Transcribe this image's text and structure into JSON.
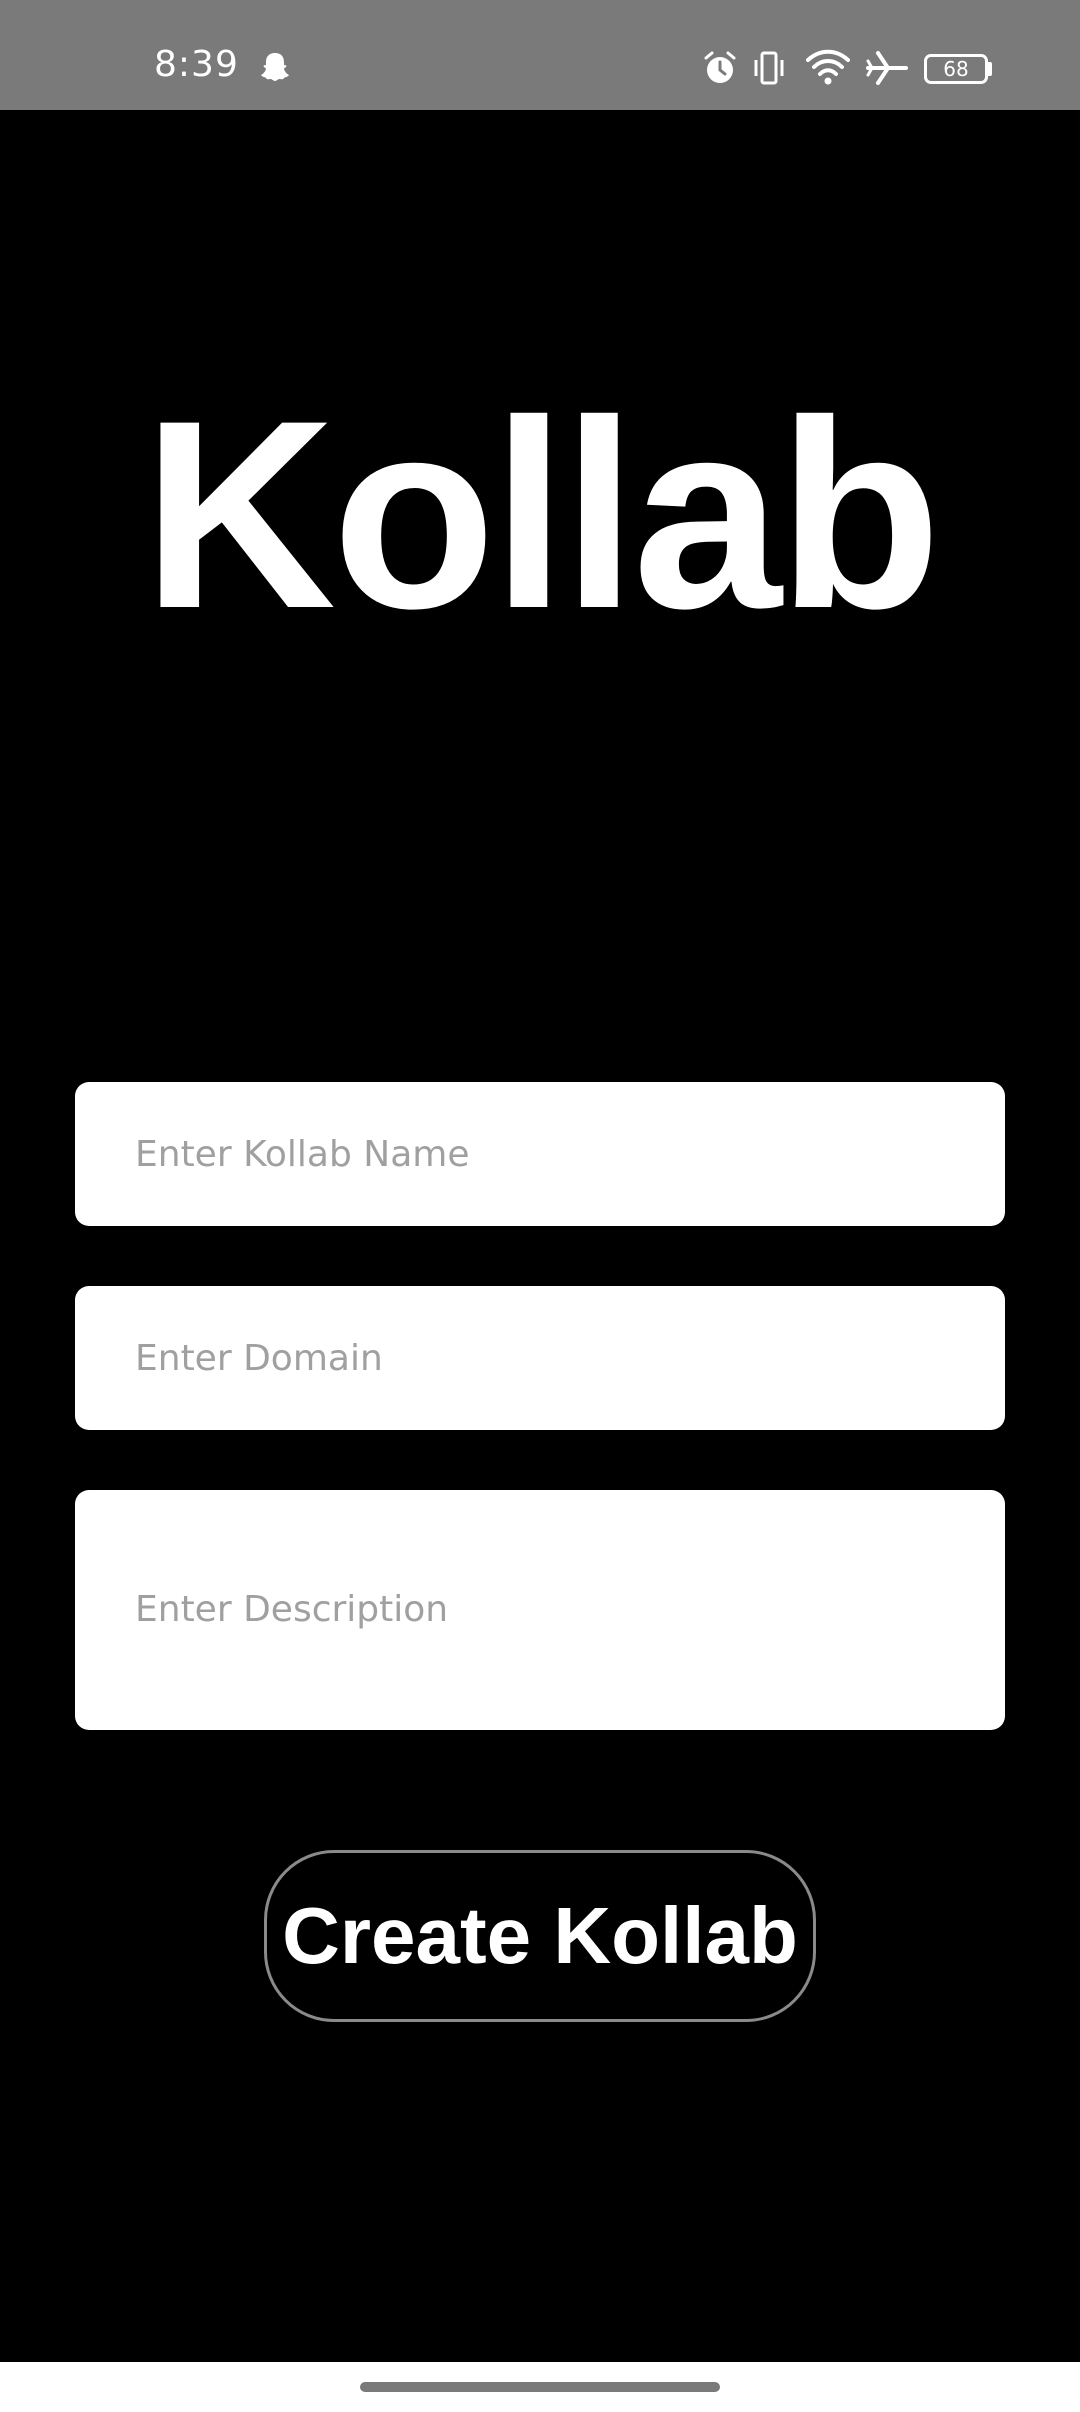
{
  "status_bar": {
    "time": "8:39",
    "battery": "68",
    "icons": [
      "snapchat-icon",
      "alarm-icon",
      "vibrate-icon",
      "wifi-icon",
      "airplane-icon",
      "battery-icon"
    ]
  },
  "app": {
    "title": "Kollab"
  },
  "form": {
    "name_placeholder": "Enter Kollab Name",
    "domain_placeholder": "Enter Domain",
    "description_placeholder": "Enter Description",
    "name_value": "",
    "domain_value": "",
    "description_value": ""
  },
  "actions": {
    "create_label": "Create Kollab"
  },
  "colors": {
    "background": "#000000",
    "status_bar": "#7a7a7a",
    "field_background": "#ffffff",
    "placeholder": "#a0a0a0",
    "button_border": "#8a8a8a"
  }
}
